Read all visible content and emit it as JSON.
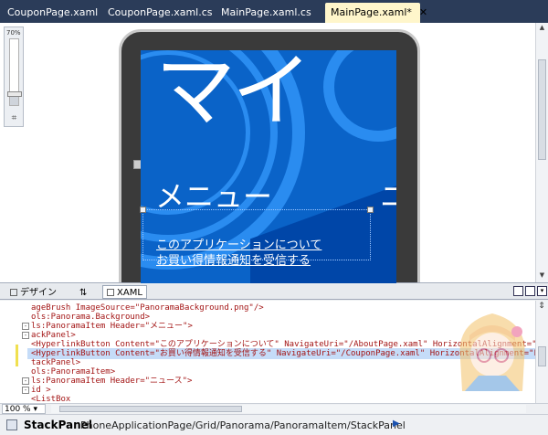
{
  "tabs": [
    {
      "label": "CouponPage.xaml",
      "active": false
    },
    {
      "label": "CouponPage.xaml.cs",
      "active": false
    },
    {
      "label": "MainPage.xaml.cs",
      "active": false
    },
    {
      "label": "MainPage.xaml*",
      "active": true
    }
  ],
  "designer": {
    "zoom_label": "70%",
    "zoom_level_fraction": 0.18,
    "panorama_title": "マイ",
    "item_header": "メニュー",
    "item_header_next": "ニ",
    "links": [
      "このアプリケーションについて",
      "お買い得情報通知を受信する"
    ]
  },
  "split_tabs": {
    "design": "デザイン",
    "swap": "⇅",
    "xaml": "XAML"
  },
  "code_lines": [
    {
      "text": "ageBrush ImageSource=\"PanoramaBackground.png\"/>",
      "fold": "",
      "highlight": false
    },
    {
      "text": "ols:Panorama.Background>",
      "fold": "",
      "highlight": false
    },
    {
      "text": "ls:PanoramaItem Header=\"メニュー\">",
      "fold": "-",
      "highlight": false
    },
    {
      "text": "ackPanel>",
      "fold": "-",
      "highlight": false
    },
    {
      "text": "<HyperlinkButton Content=\"このアプリケーションについて\" NavigateUri=\"/AboutPage.xaml\" HorizontalAlignment=\"Left\"",
      "fold": "",
      "highlight": false
    },
    {
      "text": "<HyperlinkButton Content=\"お買い得情報通知を受信する\" NavigateUri=\"/CouponPage.xaml\" HorizontalAlignment=\"Left\"",
      "fold": "",
      "highlight": true
    },
    {
      "text": "tackPanel>",
      "fold": "",
      "highlight": false
    },
    {
      "text": "ols:PanoramaItem>",
      "fold": "",
      "highlight": false
    },
    {
      "text": "ls:PanoramaItem Header=\"ニュース\">",
      "fold": "-",
      "highlight": false
    },
    {
      "text": "id >",
      "fold": "-",
      "highlight": false
    },
    {
      "text": "<ListBox",
      "fold": "",
      "highlight": false
    }
  ],
  "editor_zoom": "100 %",
  "status": {
    "root": "StackPanel",
    "path": "PhoneApplicationPage/Grid/Panorama/PanoramaItem/StackPanel",
    "arrow": "▶"
  },
  "colors": {
    "tab_strip": "#2b3c59",
    "active_tab": "#fff6cb",
    "panorama_bg": "#0a63c8",
    "code_highlight": "#c5dcf8"
  }
}
